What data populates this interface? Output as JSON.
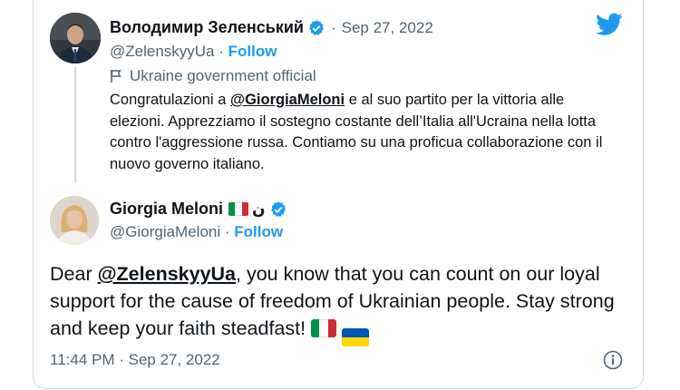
{
  "parent_tweet": {
    "display_name": "Володимир Зеленський",
    "date": "Sep 27, 2022",
    "handle": "@ZelenskyyUa",
    "follow_label": "Follow",
    "label": "Ukraine government official",
    "text_before": "Congratulazioni a ",
    "mention": "@GiorgiaMeloni",
    "text_after": " e al suo partito per la vittoria alle elezioni. Apprezziamo il sostegno costante dell’Italia all'Ucraina nella lotta contro l'aggressione russa. Contiamo su una proficua collaborazione con il nuovo governo italiano."
  },
  "reply_tweet": {
    "display_name": "Giorgia Meloni",
    "name_extra": "ن",
    "handle": "@GiorgiaMeloni",
    "follow_label": "Follow",
    "text_before": "Dear ",
    "mention": "@ZelenskyyUa",
    "text_after": ", you know that you can count on our loyal support for the cause of freedom of Ukrainian people. Stay strong and keep your faith steadfast!",
    "timestamp": "11:44 PM · Sep 27, 2022"
  },
  "separator": "·",
  "colors": {
    "twitter_blue": "#1d9bf0",
    "text": "#0f1419",
    "secondary": "#536471",
    "border": "#cfd9de"
  },
  "icons": [
    "twitter-logo-icon",
    "verified-badge-icon",
    "government-flag-icon",
    "italy-flag-icon",
    "ukraine-flag-icon",
    "info-icon"
  ]
}
